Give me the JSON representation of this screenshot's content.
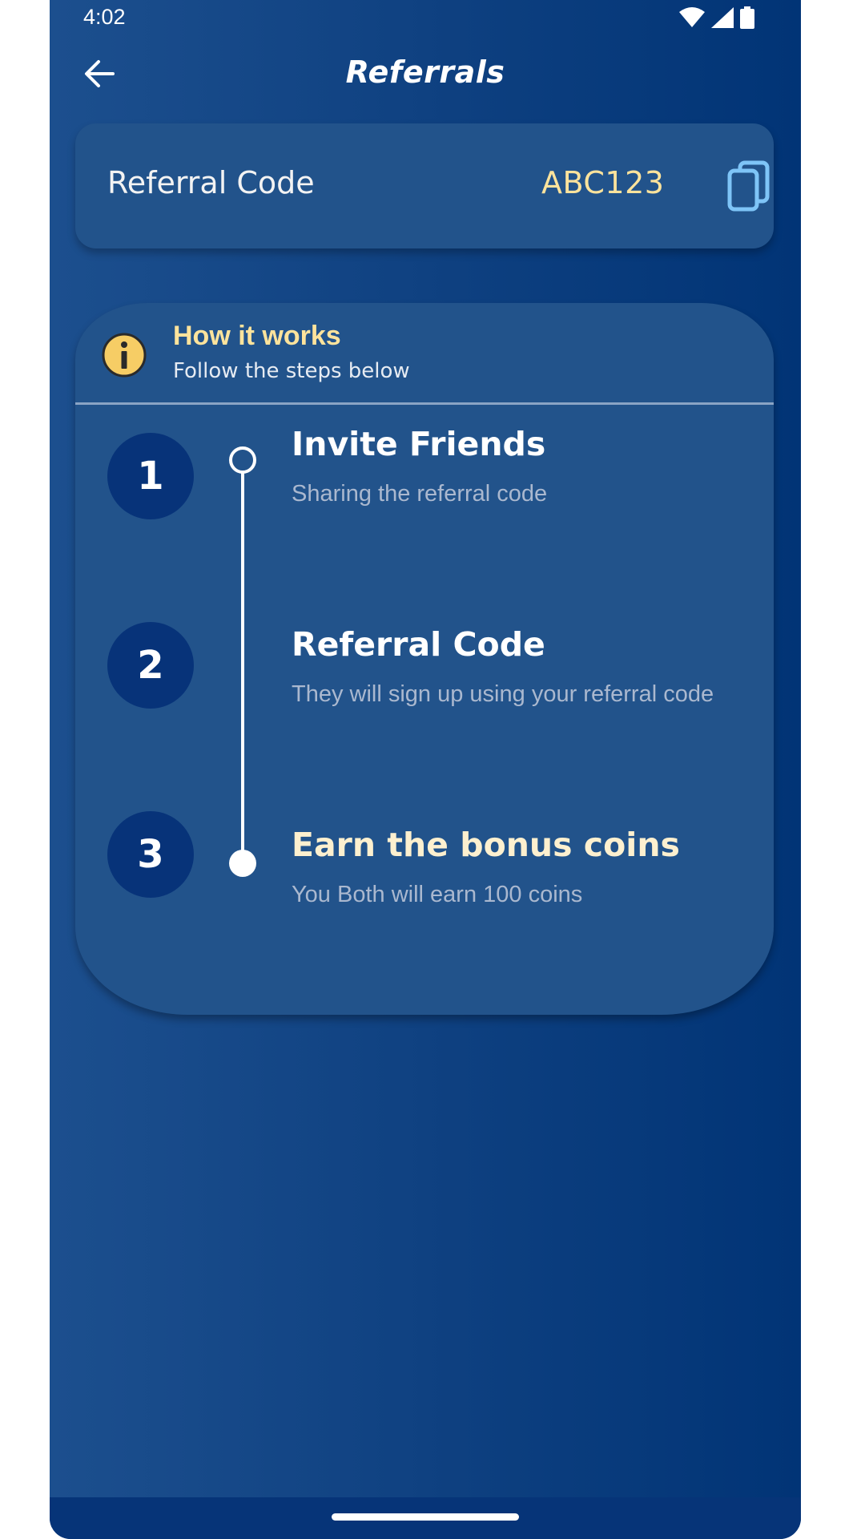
{
  "status_bar": {
    "time": "4:02"
  },
  "app_bar": {
    "title": "Referrals",
    "back_icon": "arrow-left-icon"
  },
  "referral_card": {
    "label": "Referral Code",
    "code": "ABC123",
    "copy_icon": "copy-icon"
  },
  "how_it_works": {
    "title": "How it works",
    "subtitle": "Follow the steps below",
    "info_icon": "info-icon",
    "steps": [
      {
        "number": "1",
        "title": "Invite Friends",
        "description": "Sharing the referral code"
      },
      {
        "number": "2",
        "title": "Referral Code",
        "description": "They will sign up using your referral code"
      },
      {
        "number": "3",
        "title": "Earn the bonus coins",
        "description": "You Both will earn 100 coins"
      }
    ]
  },
  "colors": {
    "background_start": "#1c4f8e",
    "background_end": "#013476",
    "card": "#22538b",
    "accent_yellow": "#fde39c",
    "step_circle": "#073379",
    "copy_icon_blue": "#7ec4f7"
  }
}
